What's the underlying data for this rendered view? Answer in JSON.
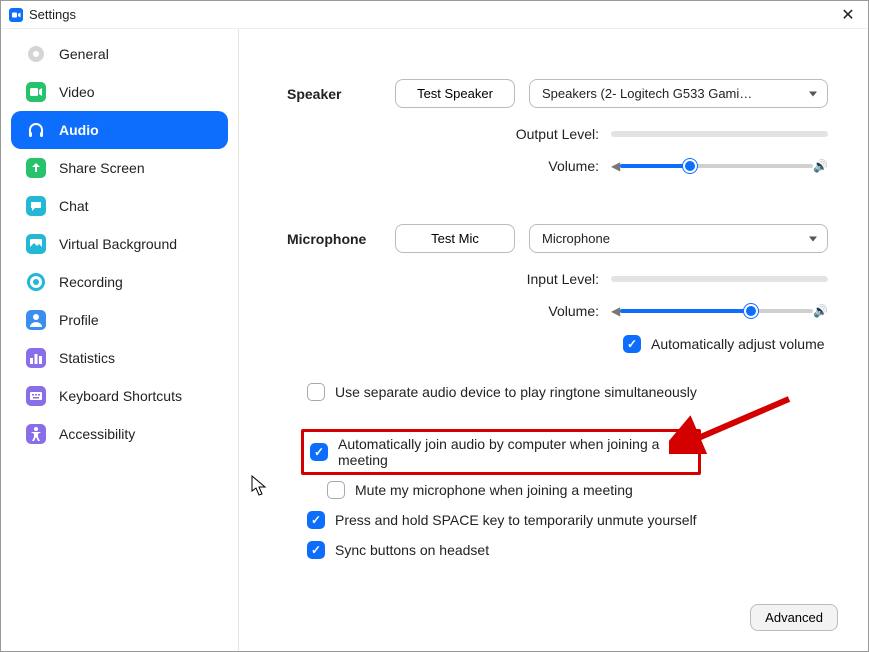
{
  "window": {
    "title": "Settings"
  },
  "sidebar": {
    "items": [
      {
        "label": "General",
        "icon": "gear"
      },
      {
        "label": "Video",
        "icon": "video"
      },
      {
        "label": "Audio",
        "icon": "headphones",
        "active": true
      },
      {
        "label": "Share Screen",
        "icon": "share"
      },
      {
        "label": "Chat",
        "icon": "chat"
      },
      {
        "label": "Virtual Background",
        "icon": "picture"
      },
      {
        "label": "Recording",
        "icon": "record"
      },
      {
        "label": "Profile",
        "icon": "person"
      },
      {
        "label": "Statistics",
        "icon": "bars"
      },
      {
        "label": "Keyboard Shortcuts",
        "icon": "keyboard"
      },
      {
        "label": "Accessibility",
        "icon": "accessibility"
      }
    ]
  },
  "audio": {
    "speaker": {
      "section_label": "Speaker",
      "test_button": "Test Speaker",
      "device": "Speakers (2- Logitech G533 Gami…",
      "output_level_label": "Output Level:",
      "volume_label": "Volume:",
      "volume_percent": 36
    },
    "microphone": {
      "section_label": "Microphone",
      "test_button": "Test Mic",
      "device": "Microphone",
      "input_level_label": "Input Level:",
      "volume_label": "Volume:",
      "volume_percent": 68,
      "auto_adjust_label": "Automatically adjust volume",
      "auto_adjust_checked": true
    },
    "options": [
      {
        "label": "Use separate audio device to play ringtone simultaneously",
        "checked": false,
        "highlighted": false
      },
      {
        "label": "Automatically join audio by computer when joining a meeting",
        "checked": true,
        "highlighted": true
      },
      {
        "label": "Mute my microphone when joining a meeting",
        "checked": false,
        "highlighted": false
      },
      {
        "label": "Press and hold SPACE key to temporarily unmute yourself",
        "checked": true,
        "highlighted": false
      },
      {
        "label": "Sync buttons on headset",
        "checked": true,
        "highlighted": false
      }
    ]
  },
  "footer": {
    "advanced_button": "Advanced"
  },
  "colors": {
    "accent": "#0d6efd",
    "arrow": "#d40000"
  }
}
